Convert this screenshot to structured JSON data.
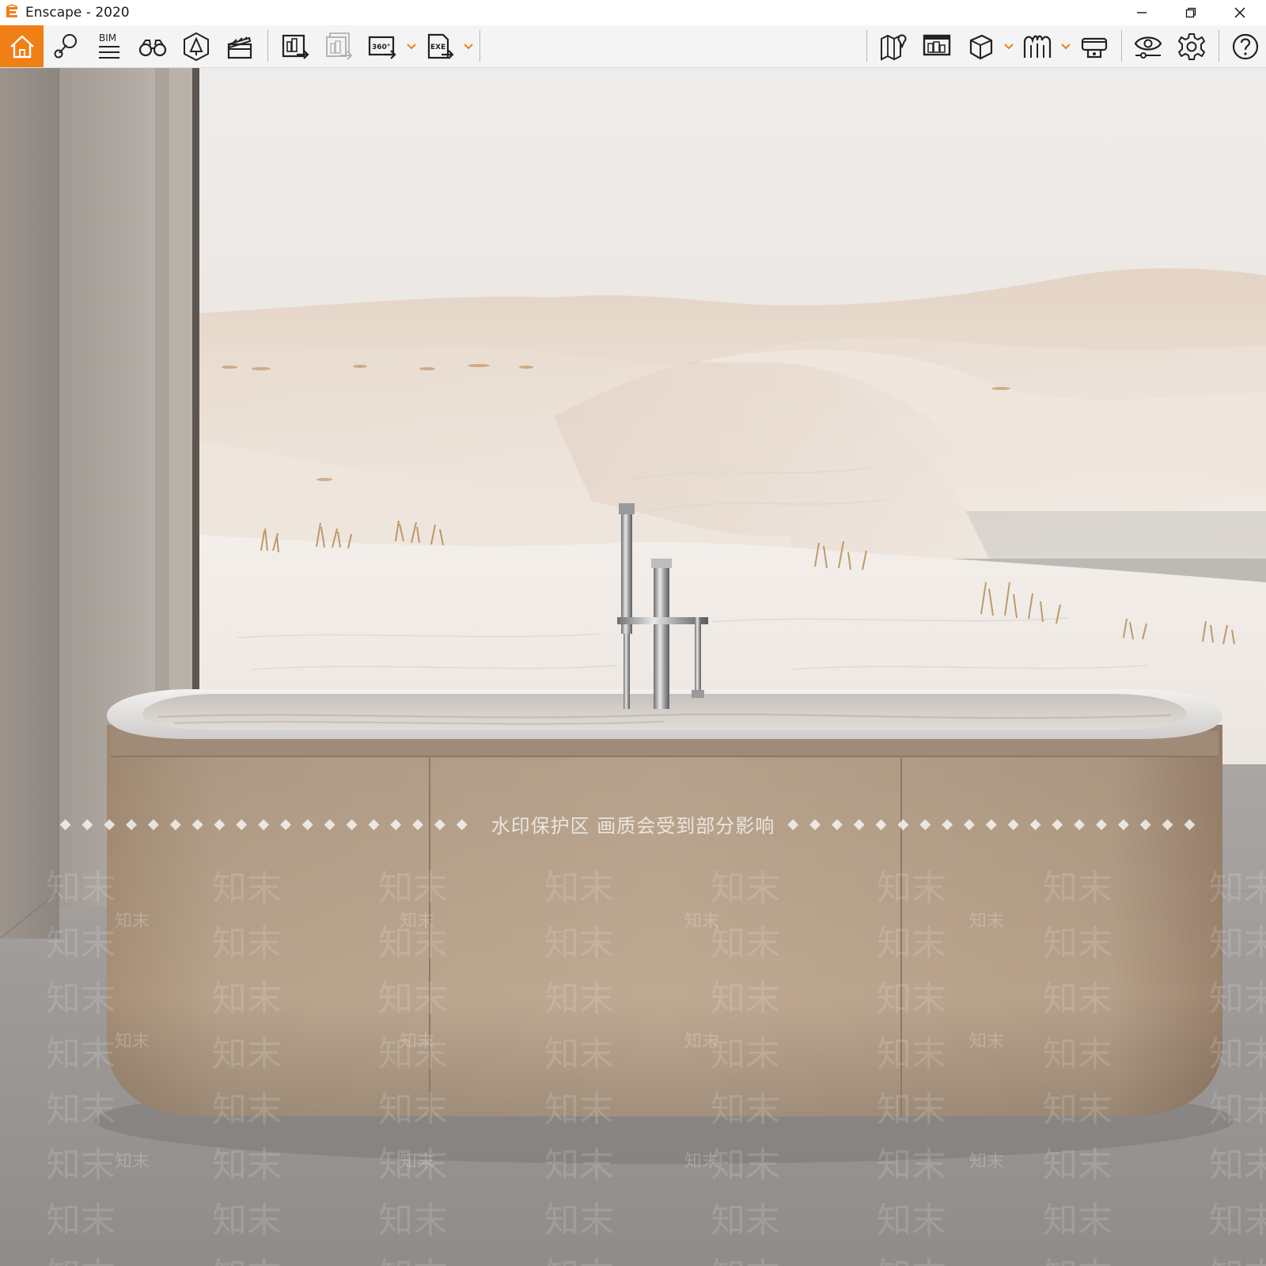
{
  "window": {
    "title": "Enscape - 2020",
    "accent_color": "#f07f15",
    "controls": {
      "minimize_icon": "minimize-icon",
      "restore_icon": "restore-icon",
      "close_icon": "close-icon"
    }
  },
  "toolbar": {
    "left_group": [
      {
        "id": "home",
        "icon": "home-icon",
        "active": true
      },
      {
        "id": "views",
        "icon": "location-pin-icon"
      },
      {
        "id": "bim",
        "icon": "bim-icon",
        "label": "BIM"
      },
      {
        "id": "binoculars",
        "icon": "binoculars-icon"
      },
      {
        "id": "atmosphere",
        "icon": "asset-library-icon"
      },
      {
        "id": "video",
        "icon": "clapperboard-icon"
      }
    ],
    "export_group": [
      {
        "id": "screenshot",
        "icon": "export-image-icon"
      },
      {
        "id": "batch",
        "icon": "batch-render-icon"
      },
      {
        "id": "panorama",
        "icon": "panorama-360-icon",
        "label": "360°",
        "dropdown": true
      },
      {
        "id": "exe",
        "icon": "export-exe-icon",
        "label": "EXE",
        "dropdown": true
      }
    ],
    "right_group": [
      {
        "id": "map",
        "icon": "map-icon"
      },
      {
        "id": "monitor",
        "icon": "monitor-icon"
      },
      {
        "id": "cube",
        "icon": "cube-icon",
        "dropdown": true
      },
      {
        "id": "vr",
        "icon": "vr-icon",
        "dropdown": true
      },
      {
        "id": "headset",
        "icon": "headset-icon"
      },
      {
        "id": "visual",
        "icon": "eye-settings-icon"
      },
      {
        "id": "settings",
        "icon": "gear-icon"
      },
      {
        "id": "help",
        "icon": "help-icon"
      }
    ],
    "collapse_icon": "chevron-up-icon"
  },
  "viewport": {
    "watermark_banner": "水印保护区   画质会受到部分影响",
    "watermark_diamonds": "◆◆◆◆◆◆◆◆◆◆◆◆◆◆◆◆◆◆◆",
    "watermark_brand": "知末"
  }
}
